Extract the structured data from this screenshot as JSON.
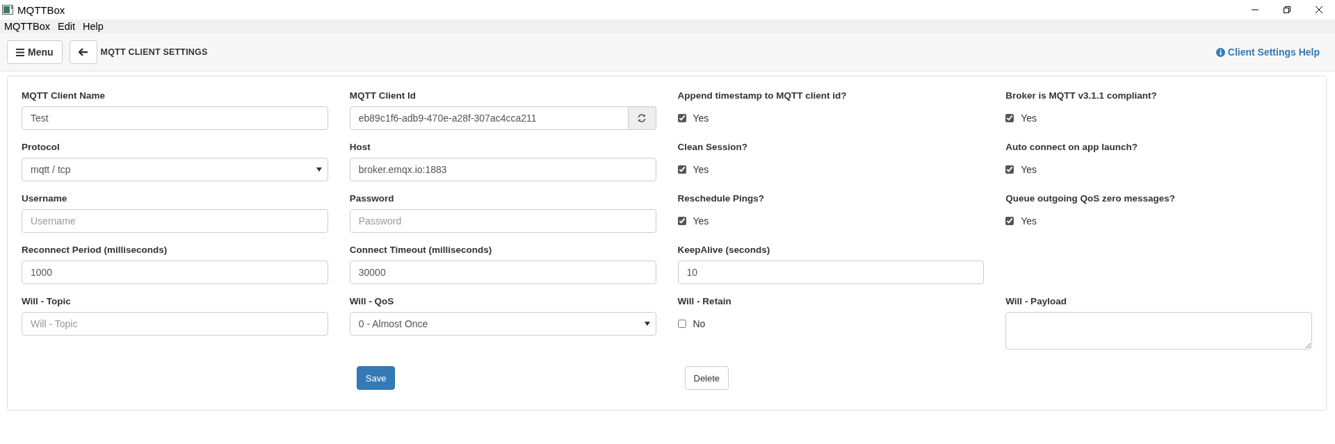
{
  "window": {
    "title": "MQTTBox"
  },
  "menu_bar": [
    "MQTTBox",
    "Edit",
    "Help"
  ],
  "toolbar": {
    "menu_button": "Menu",
    "title": "MQTT CLIENT SETTINGS",
    "help_link": "Client Settings Help"
  },
  "form_rows": [
    [
      {
        "kind": "text",
        "label": "MQTT Client Name",
        "value": "Test"
      },
      {
        "kind": "regenerate",
        "label": "MQTT Client Id",
        "value": "eb89c1f6-adb9-470e-a28f-307ac4cca211"
      },
      {
        "kind": "checkbox",
        "label": "Append timestamp to MQTT client id?",
        "option": "Yes",
        "checked": true
      },
      {
        "kind": "checkbox",
        "label": "Broker is MQTT v3.1.1 compliant?",
        "option": "Yes",
        "checked": true
      }
    ],
    [
      {
        "kind": "select",
        "label": "Protocol",
        "value": "mqtt / tcp"
      },
      {
        "kind": "text",
        "label": "Host",
        "value": "broker.emqx.io:1883"
      },
      {
        "kind": "checkbox",
        "label": "Clean Session?",
        "option": "Yes",
        "checked": true
      },
      {
        "kind": "checkbox",
        "label": "Auto connect on app launch?",
        "option": "Yes",
        "checked": true
      }
    ],
    [
      {
        "kind": "text",
        "label": "Username",
        "placeholder": "Username"
      },
      {
        "kind": "text",
        "label": "Password",
        "placeholder": "Password"
      },
      {
        "kind": "checkbox",
        "label": "Reschedule Pings?",
        "option": "Yes",
        "checked": true
      },
      {
        "kind": "checkbox",
        "label": "Queue outgoing QoS zero messages?",
        "option": "Yes",
        "checked": true
      }
    ],
    [
      {
        "kind": "text",
        "label": "Reconnect Period (milliseconds)",
        "value": "1000"
      },
      {
        "kind": "text",
        "label": "Connect Timeout (milliseconds)",
        "value": "30000"
      },
      {
        "kind": "text",
        "label": "KeepAlive (seconds)",
        "value": "10"
      }
    ],
    [
      {
        "kind": "text",
        "label": "Will - Topic",
        "placeholder": "Will - Topic"
      },
      {
        "kind": "select",
        "label": "Will - QoS",
        "value": "0 - Almost Once"
      },
      {
        "kind": "checkbox",
        "label": "Will - Retain",
        "option": "No",
        "checked": false
      },
      {
        "kind": "textarea",
        "label": "Will - Payload"
      }
    ]
  ],
  "buttons": [
    {
      "kind": "primary",
      "label": "Save"
    },
    {
      "kind": "default",
      "label": "Delete"
    }
  ]
}
